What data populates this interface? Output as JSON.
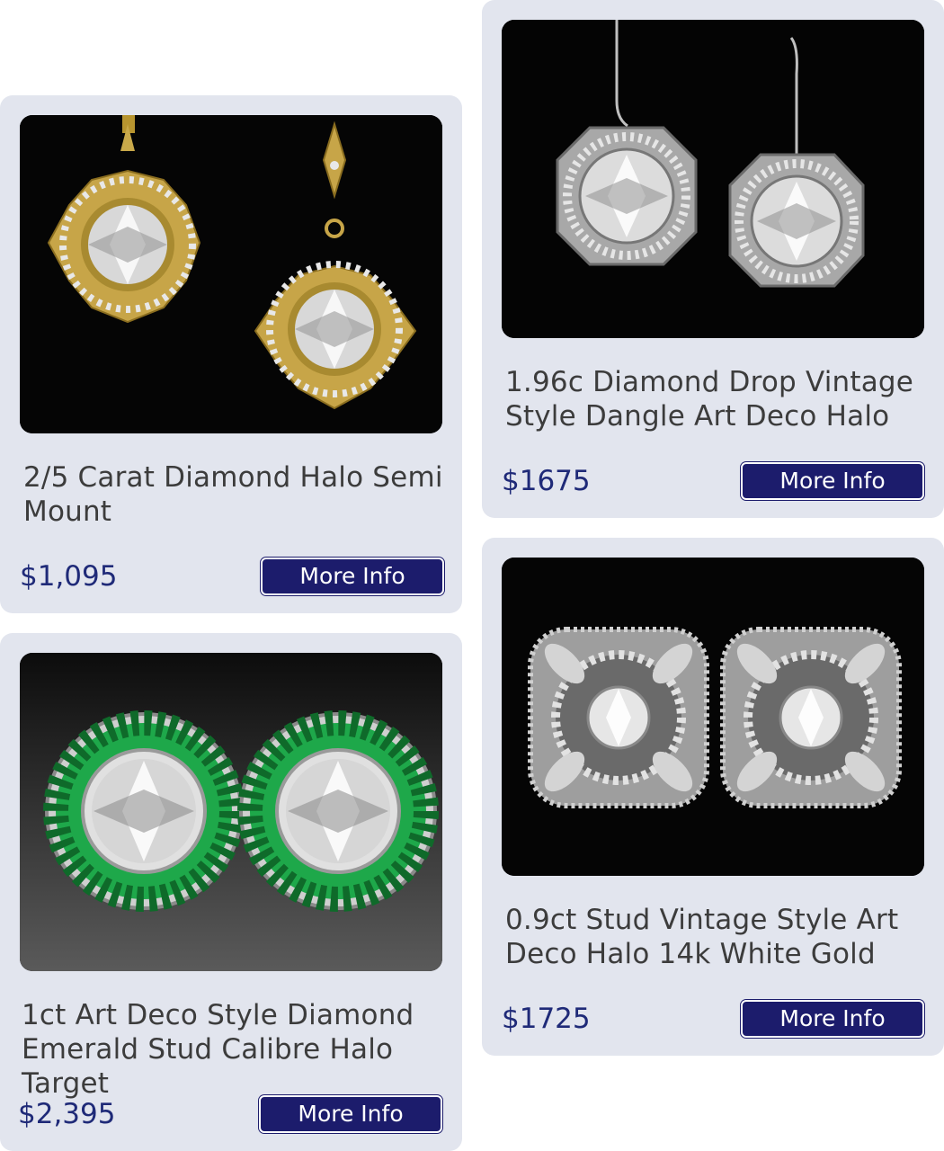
{
  "products": [
    {
      "title": "2/5 Carat Diamond Halo Semi Mount",
      "price": "$1,095",
      "button_label": "More Info",
      "image_icon": "gold-halo-dangle-earrings-photo"
    },
    {
      "title": "1.96c Diamond Drop Vintage Style Dangle Art Deco Halo",
      "price": "$1675",
      "button_label": "More Info",
      "image_icon": "octagon-halo-drop-earrings-photo"
    },
    {
      "title": "1ct Art Deco Style Diamond Emerald Stud Calibre Halo Target",
      "price": "$2,395",
      "button_label": "More Info",
      "image_icon": "emerald-halo-stud-earrings-photo"
    },
    {
      "title": "0.9ct Stud Vintage Style Art Deco Halo 14k White Gold",
      "price": "$1725",
      "button_label": "More Info",
      "image_icon": "art-deco-stud-earrings-photo"
    }
  ],
  "colors": {
    "card_background": "#e2e5ee",
    "price_text": "#1f2a78",
    "button_background": "#1c1c6c",
    "title_text": "#3c3c3c"
  }
}
